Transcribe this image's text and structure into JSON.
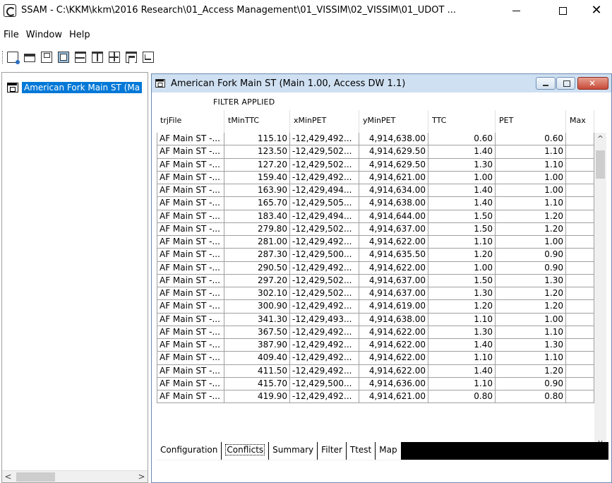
{
  "window": {
    "title": "SSAM - C:\\KKM\\kkm\\2016 Research\\01_Access Management\\01_VISSIM\\02_VISSIM\\01_UDOT ...",
    "minimize_glyph": "—",
    "maximize_glyph": "☐",
    "close_glyph": "✕"
  },
  "menu": [
    {
      "label": "File"
    },
    {
      "label": "Window"
    },
    {
      "label": "Help"
    }
  ],
  "toolbar": {
    "icons": [
      "new-icon",
      "open-icon",
      "save-icon",
      "cascade-icon",
      "tile-horizontal-icon",
      "tile-vertical-icon",
      "arrange-icon",
      "stack-icon",
      "report-icon"
    ]
  },
  "tree": {
    "item_label": "American Fork Main ST (Ma",
    "scroll_left": "<",
    "scroll_right": ">"
  },
  "child": {
    "title": "American Fork Main ST (Main 1.00, Access DW 1.1)",
    "filter_label": "FILTER APPLIED",
    "columns": [
      "trjFile",
      "tMinTTC",
      "xMinPET",
      "yMinPET",
      "TTC",
      "PET",
      "Max"
    ],
    "rows": [
      [
        "AF Main ST -...",
        "115.10",
        "-12,429,492...",
        "4,914,638.00",
        "0.60",
        "0.60",
        ""
      ],
      [
        "AF Main ST -...",
        "123.50",
        "-12,429,502...",
        "4,914,629.50",
        "1.40",
        "1.10",
        ""
      ],
      [
        "AF Main ST -...",
        "127.20",
        "-12,429,502...",
        "4,914,629.50",
        "1.30",
        "1.10",
        ""
      ],
      [
        "AF Main ST -...",
        "159.40",
        "-12,429,492...",
        "4,914,621.00",
        "1.00",
        "1.00",
        ""
      ],
      [
        "AF Main ST -...",
        "163.90",
        "-12,429,494...",
        "4,914,634.00",
        "1.40",
        "1.00",
        ""
      ],
      [
        "AF Main ST -...",
        "165.70",
        "-12,429,505...",
        "4,914,638.00",
        "1.40",
        "1.10",
        ""
      ],
      [
        "AF Main ST -...",
        "183.40",
        "-12,429,494...",
        "4,914,644.00",
        "1.50",
        "1.20",
        ""
      ],
      [
        "AF Main ST -...",
        "279.80",
        "-12,429,502...",
        "4,914,637.00",
        "1.50",
        "1.20",
        ""
      ],
      [
        "AF Main ST -...",
        "281.00",
        "-12,429,492...",
        "4,914,622.00",
        "1.10",
        "1.00",
        ""
      ],
      [
        "AF Main ST -...",
        "287.30",
        "-12,429,500...",
        "4,914,635.50",
        "1.20",
        "0.90",
        ""
      ],
      [
        "AF Main ST -...",
        "290.50",
        "-12,429,492...",
        "4,914,622.00",
        "1.00",
        "0.90",
        ""
      ],
      [
        "AF Main ST -...",
        "297.20",
        "-12,429,502...",
        "4,914,637.00",
        "1.50",
        "1.30",
        ""
      ],
      [
        "AF Main ST -...",
        "302.10",
        "-12,429,502...",
        "4,914,637.00",
        "1.30",
        "1.20",
        ""
      ],
      [
        "AF Main ST -...",
        "300.90",
        "-12,429,492...",
        "4,914,619.00",
        "1.20",
        "1.20",
        ""
      ],
      [
        "AF Main ST -...",
        "341.30",
        "-12,429,493...",
        "4,914,638.00",
        "1.10",
        "1.00",
        ""
      ],
      [
        "AF Main ST -...",
        "367.50",
        "-12,429,492...",
        "4,914,622.00",
        "1.30",
        "1.10",
        ""
      ],
      [
        "AF Main ST -...",
        "387.90",
        "-12,429,492...",
        "4,914,622.00",
        "1.40",
        "1.30",
        ""
      ],
      [
        "AF Main ST -...",
        "409.40",
        "-12,429,492...",
        "4,914,622.00",
        "1.10",
        "1.10",
        ""
      ],
      [
        "AF Main ST -...",
        "411.50",
        "-12,429,492...",
        "4,914,622.00",
        "1.40",
        "1.20",
        ""
      ],
      [
        "AF Main ST -...",
        "415.70",
        "-12,429,500...",
        "4,914,636.00",
        "1.10",
        "0.90",
        ""
      ],
      [
        "AF Main ST -...",
        "419.90",
        "-12,429,492...",
        "4,914,621.00",
        "0.80",
        "0.80",
        ""
      ]
    ],
    "scroll": {
      "up": "^",
      "down": "v",
      "left": "<",
      "right": ">"
    },
    "tabs": [
      {
        "label": "Configuration",
        "active": false
      },
      {
        "label": "Conflicts",
        "active": true
      },
      {
        "label": "Summary",
        "active": false
      },
      {
        "label": "Filter",
        "active": false
      },
      {
        "label": "Ttest",
        "active": false
      },
      {
        "label": "Map",
        "active": false
      }
    ]
  }
}
